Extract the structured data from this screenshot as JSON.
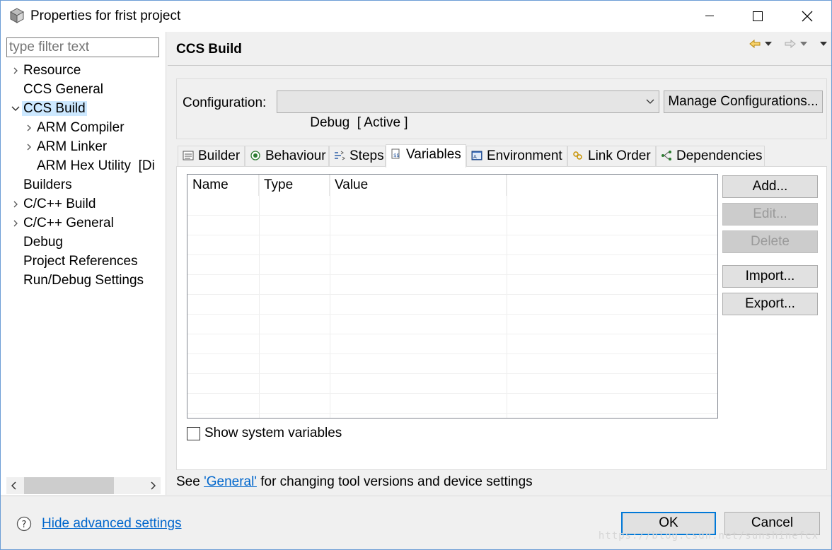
{
  "window": {
    "title": "Properties for frist project",
    "controls": [
      "minimize",
      "maximize",
      "close"
    ]
  },
  "sidebar": {
    "filter_placeholder": "type filter text",
    "items": [
      {
        "label": "Resource",
        "expandable": true,
        "expanded": false,
        "indent": 0
      },
      {
        "label": "CCS General",
        "expandable": false,
        "indent": 0
      },
      {
        "label": "CCS Build",
        "expandable": true,
        "expanded": true,
        "indent": 0,
        "selected": true
      },
      {
        "label": "ARM Compiler",
        "expandable": true,
        "expanded": false,
        "indent": 1
      },
      {
        "label": "ARM Linker",
        "expandable": true,
        "expanded": false,
        "indent": 1
      },
      {
        "label": "ARM Hex Utility  [Di",
        "expandable": false,
        "indent": 1
      },
      {
        "label": "Builders",
        "expandable": false,
        "indent": 0
      },
      {
        "label": "C/C++ Build",
        "expandable": true,
        "expanded": false,
        "indent": 0
      },
      {
        "label": "C/C++ General",
        "expandable": true,
        "expanded": false,
        "indent": 0
      },
      {
        "label": "Debug",
        "expandable": false,
        "indent": 0
      },
      {
        "label": "Project References",
        "expandable": false,
        "indent": 0
      },
      {
        "label": "Run/Debug Settings",
        "expandable": false,
        "indent": 0
      }
    ]
  },
  "main": {
    "page_title": "CCS Build",
    "configuration": {
      "label": "Configuration:",
      "value": "Debug  [ Active ]",
      "manage_label": "Manage Configurations..."
    },
    "tabs": [
      {
        "label": "Builder",
        "icon": "builder-icon"
      },
      {
        "label": "Behaviour",
        "icon": "behaviour-icon"
      },
      {
        "label": "Steps",
        "icon": "steps-icon"
      },
      {
        "label": "Variables",
        "icon": "variables-icon",
        "active": true
      },
      {
        "label": "Environment",
        "icon": "environment-icon"
      },
      {
        "label": "Link Order",
        "icon": "link-order-icon"
      },
      {
        "label": "Dependencies",
        "icon": "dependencies-icon"
      }
    ],
    "table": {
      "columns": [
        "Name",
        "Type",
        "Value",
        ""
      ],
      "rows": []
    },
    "buttons": {
      "add": "Add...",
      "edit": "Edit...",
      "delete": "Delete",
      "import": "Import...",
      "export": "Export..."
    },
    "show_system_variables": {
      "label": "Show system variables",
      "checked": false
    },
    "footnote": {
      "prefix": "See ",
      "link": "'General'",
      "suffix": " for changing tool versions and device settings"
    }
  },
  "footer": {
    "hide_advanced": "Hide advanced settings",
    "ok": "OK",
    "cancel": "Cancel",
    "watermark": "https://blog.csdn.net/sunshinefcx"
  },
  "colors": {
    "accent": "#0078d7",
    "link": "#0066cc",
    "selection": "#cce8ff"
  }
}
